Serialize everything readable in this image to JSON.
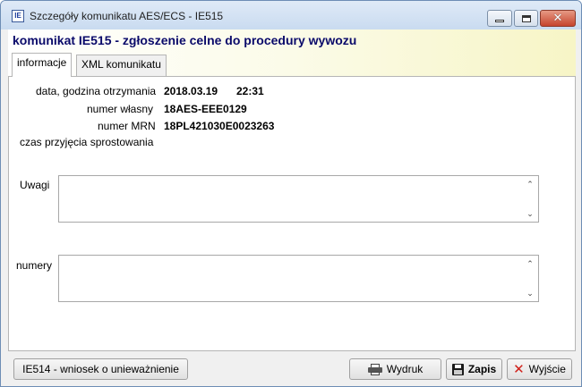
{
  "window": {
    "app_icon_text": "IE",
    "title": "Szczegóły komunikatu AES/ECS - IE515"
  },
  "header": {
    "title": "komunikat IE515 - zgłoszenie celne do procedury wywozu"
  },
  "tabs": [
    {
      "label": "informacje",
      "active": true
    },
    {
      "label": "XML komunikatu",
      "active": false
    }
  ],
  "info": {
    "received_label": "data, godzina otrzymania",
    "received_date": "2018.03.19",
    "received_time": "22:31",
    "own_number_label": "numer własny",
    "own_number": "18AES-EEE0129",
    "mrn_label": "numer MRN",
    "mrn": "18PL421030E0023263",
    "correction_time_label": "czas przyjęcia sprostowania",
    "correction_time": ""
  },
  "remarks": {
    "label": "Uwagi",
    "value": ""
  },
  "numbers": {
    "label": "numery",
    "value": ""
  },
  "buttons": {
    "ie514": "IE514 - wniosek o unieważnienie",
    "print": "Wydruk",
    "save": "Zapis",
    "exit": "Wyjście"
  },
  "icons": {
    "print": "printer-icon",
    "save": "floppy-disk-icon",
    "exit": "red-x-icon"
  },
  "colors": {
    "header_text": "#0a0a6a",
    "header_gradient_end": "#f7f5c6",
    "exit_icon": "#d0201a"
  }
}
